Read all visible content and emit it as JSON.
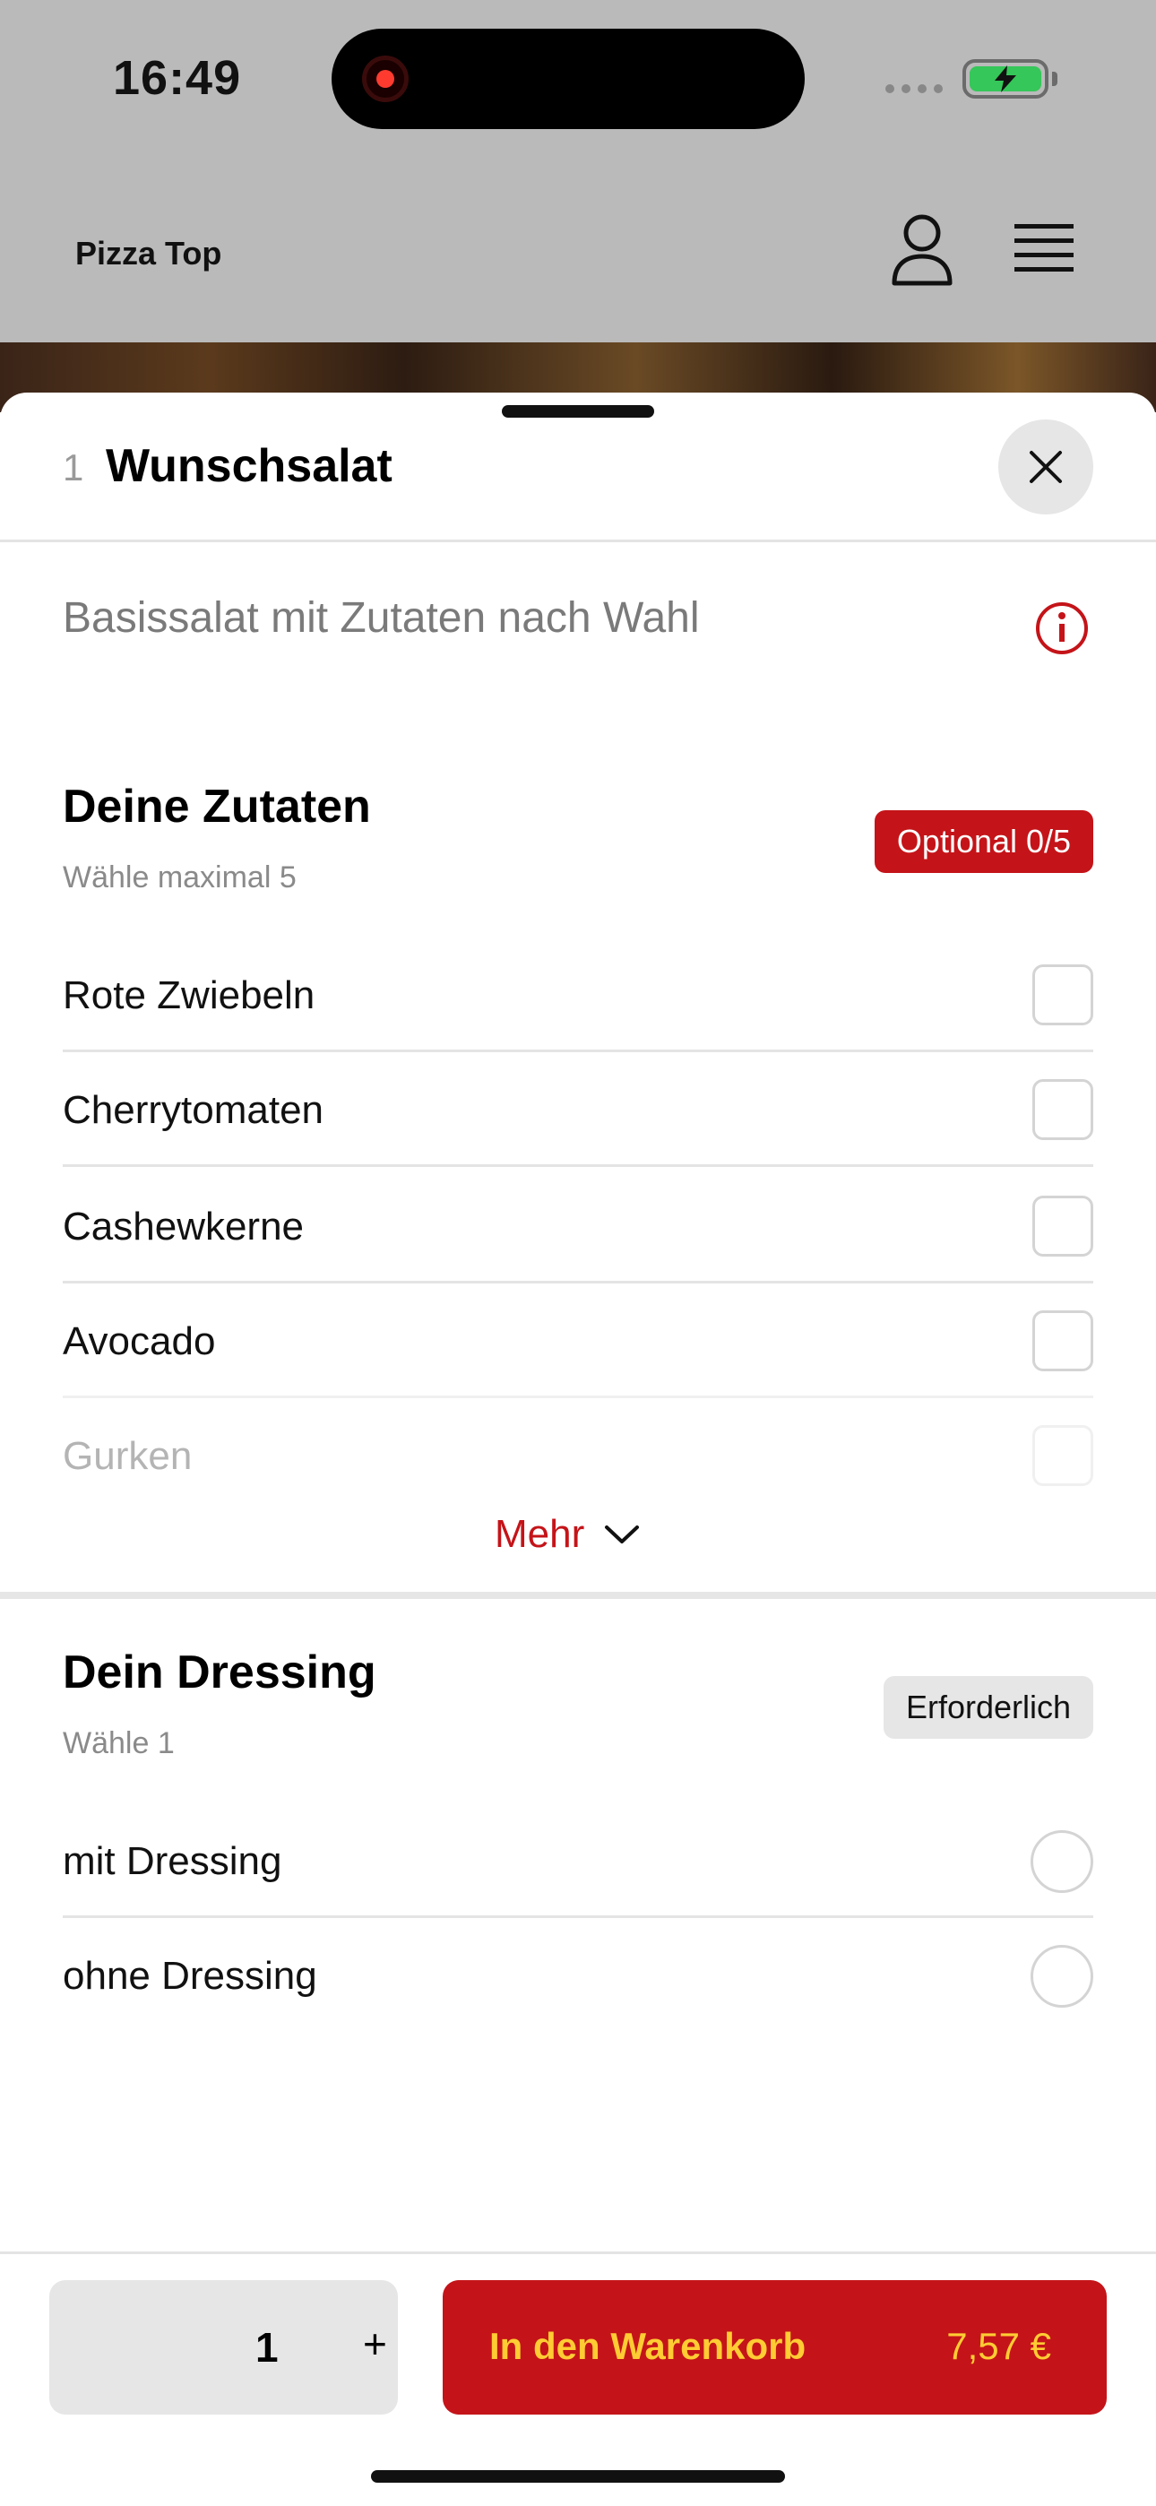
{
  "status_bar": {
    "time": "16:49"
  },
  "background_page": {
    "brand": "Pizza Top"
  },
  "sheet": {
    "quantity_prefix": "1",
    "title": "Wunschsalat",
    "description": "Basissalat mit Zutaten nach Wahl"
  },
  "ingredients": {
    "title": "Deine Zutaten",
    "subtitle": "Wähle maximal 5",
    "badge": "Optional 0/5",
    "items": [
      {
        "label": "Rote Zwiebeln"
      },
      {
        "label": "Cherrytomaten"
      },
      {
        "label": "Cashewkerne"
      },
      {
        "label": "Avocado"
      },
      {
        "label": "Gurken"
      }
    ],
    "more_label": "Mehr"
  },
  "dressing": {
    "title": "Dein Dressing",
    "subtitle": "Wähle 1",
    "badge": "Erforderlich",
    "options": [
      {
        "label": "mit Dressing"
      },
      {
        "label": "ohne Dressing"
      }
    ]
  },
  "footer": {
    "quantity": "1",
    "plus": "+",
    "cart_label": "In den Warenkorb",
    "price": "7,57 €"
  },
  "colors": {
    "accent_red": "#c41419",
    "cart_text_yellow": "#ffcc33",
    "dim_overlay": "#bababa"
  },
  "icons": [
    "record-icon",
    "battery-charging-icon",
    "account-icon",
    "menu-icon",
    "close-icon",
    "info-icon",
    "chevron-down-icon"
  ]
}
